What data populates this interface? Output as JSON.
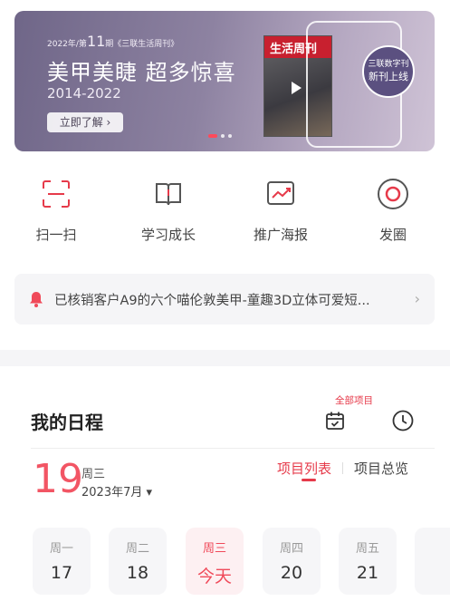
{
  "banner": {
    "issue_prefix": "2022年/第",
    "issue_num": "11",
    "issue_suffix": "期《三联生活周刊》",
    "headline": "美甲美睫 超多惊喜",
    "years": "2014-2022",
    "cta": "立即了解 ›",
    "magazine_title": "生活周刊",
    "badge_line1": "三联数字刊",
    "badge_line2": "新刊上线",
    "carousel": {
      "count": 3,
      "active": 0
    }
  },
  "actions": [
    {
      "label": "扫一扫",
      "icon": "scan-icon"
    },
    {
      "label": "学习成长",
      "icon": "book-icon"
    },
    {
      "label": "推广海报",
      "icon": "poster-trend-icon"
    },
    {
      "label": "发圈",
      "icon": "circle-target-icon"
    }
  ],
  "notice": {
    "text": "已核销客户A9的六个喵伦敦美甲-童趣3D立体可爱短...",
    "chevron": "›"
  },
  "schedule": {
    "title": "我的日程",
    "all_projects": "全部项目",
    "date_day": "19",
    "weekday": "周三",
    "year_month": "2023年7月 ▾",
    "tabs": [
      "项目列表",
      "项目总览"
    ],
    "active_tab": 0,
    "week": [
      {
        "weekday": "周一",
        "day": "17"
      },
      {
        "weekday": "周二",
        "day": "18"
      },
      {
        "weekday": "周三",
        "day": "今天"
      },
      {
        "weekday": "周四",
        "day": "20"
      },
      {
        "weekday": "周五",
        "day": "21"
      }
    ]
  },
  "colors": {
    "accent": "#e63a4a",
    "date": "#f25564"
  }
}
